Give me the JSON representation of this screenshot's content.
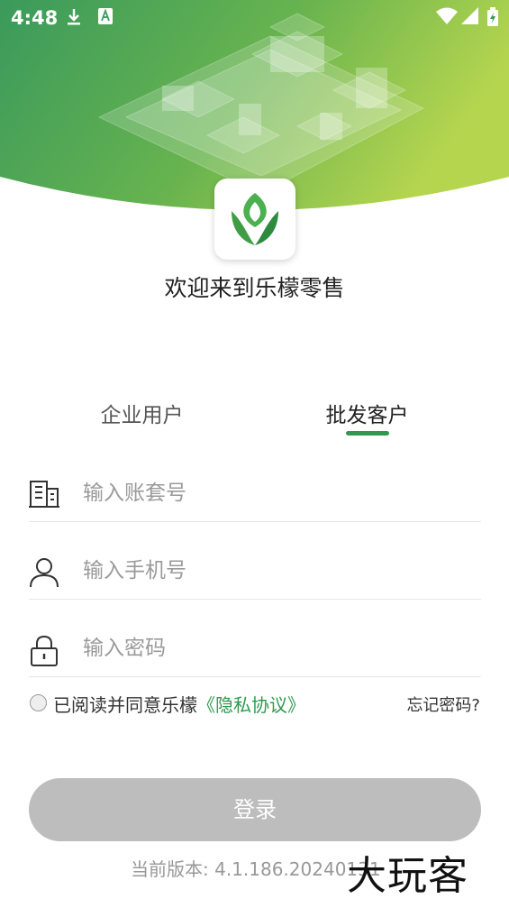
{
  "status_bar": {
    "time": "4:48"
  },
  "header": {
    "welcome_text": "欢迎来到乐檬零售"
  },
  "tabs": [
    {
      "label": "企业用户",
      "selected": false
    },
    {
      "label": "批发客户",
      "selected": true
    }
  ],
  "form": {
    "account_placeholder": "输入账套号",
    "phone_placeholder": "输入手机号",
    "password_placeholder": "输入密码"
  },
  "agreement": {
    "prefix": "已阅读并同意乐檬",
    "link_text": "《隐私协议》",
    "checked": false
  },
  "forgot_password": "忘记密码?",
  "login_button": "登录",
  "version": "当前版本: 4.1.186.20240131",
  "watermark": "大玩客",
  "colors": {
    "accent": "#2f9a4f",
    "button_disabled": "#bdbdbd",
    "header_start": "#3c9a5a",
    "header_end": "#a9cf4f"
  }
}
